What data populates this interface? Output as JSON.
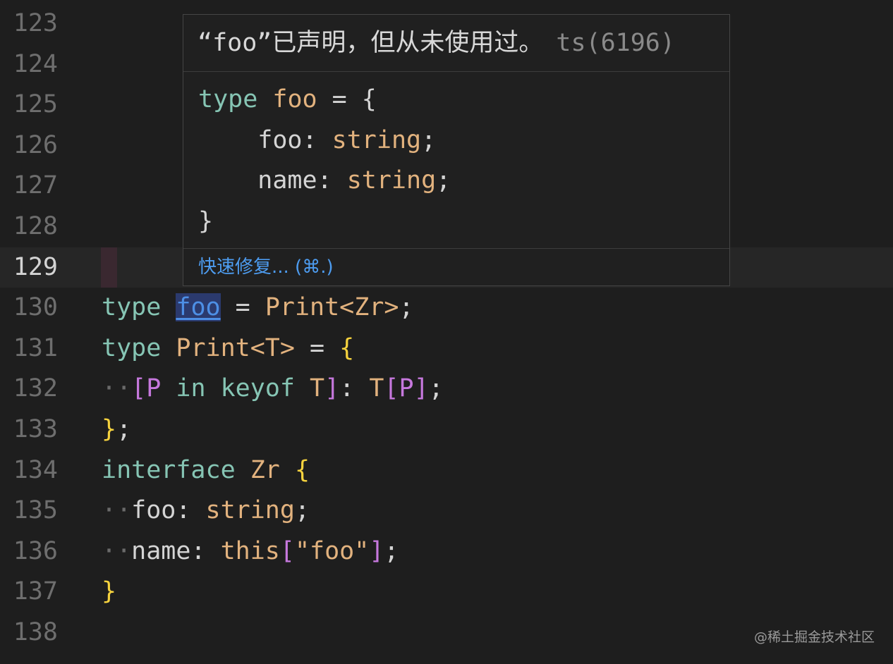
{
  "editor": {
    "lines": [
      {
        "num": "123"
      },
      {
        "num": "124"
      },
      {
        "num": "125"
      },
      {
        "num": "126"
      },
      {
        "num": "127"
      },
      {
        "num": "128"
      },
      {
        "num": "129"
      },
      {
        "num": "130"
      },
      {
        "num": "131"
      },
      {
        "num": "132"
      },
      {
        "num": "133"
      },
      {
        "num": "134"
      },
      {
        "num": "135"
      },
      {
        "num": "136"
      },
      {
        "num": "137"
      },
      {
        "num": "138"
      }
    ],
    "code": {
      "l130": {
        "kw": "type",
        "name": "foo",
        "eq": " = ",
        "print": "Print",
        "lt": "<",
        "zr": "Zr",
        "gt": ">",
        "semi": ";"
      },
      "l131": {
        "kw": "type",
        "print": "Print<T>",
        "eq": " = ",
        "brace": "{"
      },
      "l132": {
        "dots": "··",
        "open": "[",
        "p": "P",
        "in": " in ",
        "keyof": "keyof",
        "t": " T",
        "close": "]",
        "colon": ": ",
        "t2": "T",
        "open2": "[",
        "p2": "P",
        "close2": "]",
        "semi": ";"
      },
      "l133": {
        "brace": "}",
        "semi": ";"
      },
      "l134": {
        "kw": "interface",
        "zr": "Zr",
        "brace": "{"
      },
      "l135": {
        "dots": "··",
        "prop": "foo: ",
        "type": "string",
        "semi": ";"
      },
      "l136": {
        "dots": "··",
        "prop": "name: ",
        "this": "this",
        "open": "[",
        "str": "\"foo\"",
        "close": "]",
        "semi": ";"
      },
      "l137": {
        "brace": "}"
      }
    }
  },
  "hover": {
    "message": "“foo”已声明，但从未使用过。",
    "error_code": "ts(6196)",
    "preview": {
      "line1": {
        "kw": "type",
        "name": "foo",
        "rest": " = {"
      },
      "line2": {
        "prop": "    foo: ",
        "type": "string",
        "semi": ";"
      },
      "line3": {
        "prop": "    name: ",
        "type": "string",
        "semi": ";"
      },
      "line4": {
        "brace": "}"
      }
    },
    "quick_fix_label": "快速修复... (⌘.)"
  },
  "watermark": "@稀土掘金技术社区",
  "colors": {
    "background": "#1e1e1e",
    "keyword": "#86c5b4",
    "type": "#e2b27e",
    "bracket_yellow": "#f5d23e",
    "bracket_purple": "#c678dd",
    "link": "#4d9cf0"
  }
}
